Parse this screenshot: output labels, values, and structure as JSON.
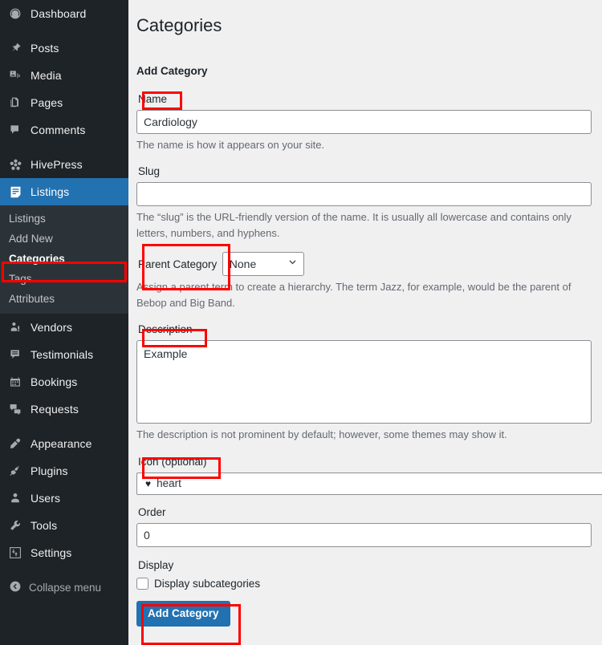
{
  "sidebar": {
    "items": [
      {
        "label": "Dashboard",
        "icon": "dashboard-icon"
      },
      {
        "label": "Posts",
        "icon": "pin-icon"
      },
      {
        "label": "Media",
        "icon": "media-icon"
      },
      {
        "label": "Pages",
        "icon": "pages-icon"
      },
      {
        "label": "Comments",
        "icon": "comments-icon"
      },
      {
        "label": "HivePress",
        "icon": "hivepress-icon"
      },
      {
        "label": "Listings",
        "icon": "listings-icon"
      },
      {
        "label": "Vendors",
        "icon": "vendors-icon"
      },
      {
        "label": "Testimonials",
        "icon": "testimonials-icon"
      },
      {
        "label": "Bookings",
        "icon": "bookings-icon"
      },
      {
        "label": "Requests",
        "icon": "requests-icon"
      },
      {
        "label": "Appearance",
        "icon": "appearance-icon"
      },
      {
        "label": "Plugins",
        "icon": "plugins-icon"
      },
      {
        "label": "Users",
        "icon": "users-icon"
      },
      {
        "label": "Tools",
        "icon": "tools-icon"
      },
      {
        "label": "Settings",
        "icon": "settings-icon"
      }
    ],
    "submenu": [
      {
        "label": "Listings"
      },
      {
        "label": "Add New"
      },
      {
        "label": "Categories"
      },
      {
        "label": "Tags"
      },
      {
        "label": "Attributes"
      }
    ],
    "collapse_label": "Collapse menu",
    "active_item": "Listings",
    "active_submenu": "Categories",
    "accent_color": "#2271b1",
    "background_color": "#1d2327",
    "submenu_background": "#2c3338"
  },
  "main": {
    "page_title": "Categories",
    "section_heading": "Add Category",
    "fields": {
      "name": {
        "label": "Name",
        "value": "Cardiology",
        "help": "The name is how it appears on your site."
      },
      "slug": {
        "label": "Slug",
        "value": "",
        "help": "The “slug” is the URL-friendly version of the name. It is usually all lowercase and contains only letters, numbers, and hyphens."
      },
      "parent": {
        "label": "Parent Category",
        "value": "None",
        "help": "Assign a parent term to create a hierarchy. The term Jazz, for example, would be the parent of Bebop and Big Band."
      },
      "description": {
        "label": "Description",
        "value": "Example",
        "help": "The description is not prominent by default; however, some themes may show it."
      },
      "icon": {
        "label": "Icon (optional)",
        "value": "heart",
        "glyph": "♥"
      },
      "order": {
        "label": "Order",
        "value": "0"
      },
      "display": {
        "label": "Display",
        "checkbox_label": "Display subcategories",
        "checked": false
      }
    },
    "submit_label": "Add Category",
    "submit_color": "#2271b1"
  },
  "annotations": {
    "color": "#ff0000",
    "boxes": [
      {
        "name": "categories-menu-highlight"
      },
      {
        "name": "name-label-highlight"
      },
      {
        "name": "parent-category-highlight"
      },
      {
        "name": "description-label-highlight"
      },
      {
        "name": "icon-label-highlight"
      },
      {
        "name": "add-category-button-highlight"
      }
    ]
  }
}
